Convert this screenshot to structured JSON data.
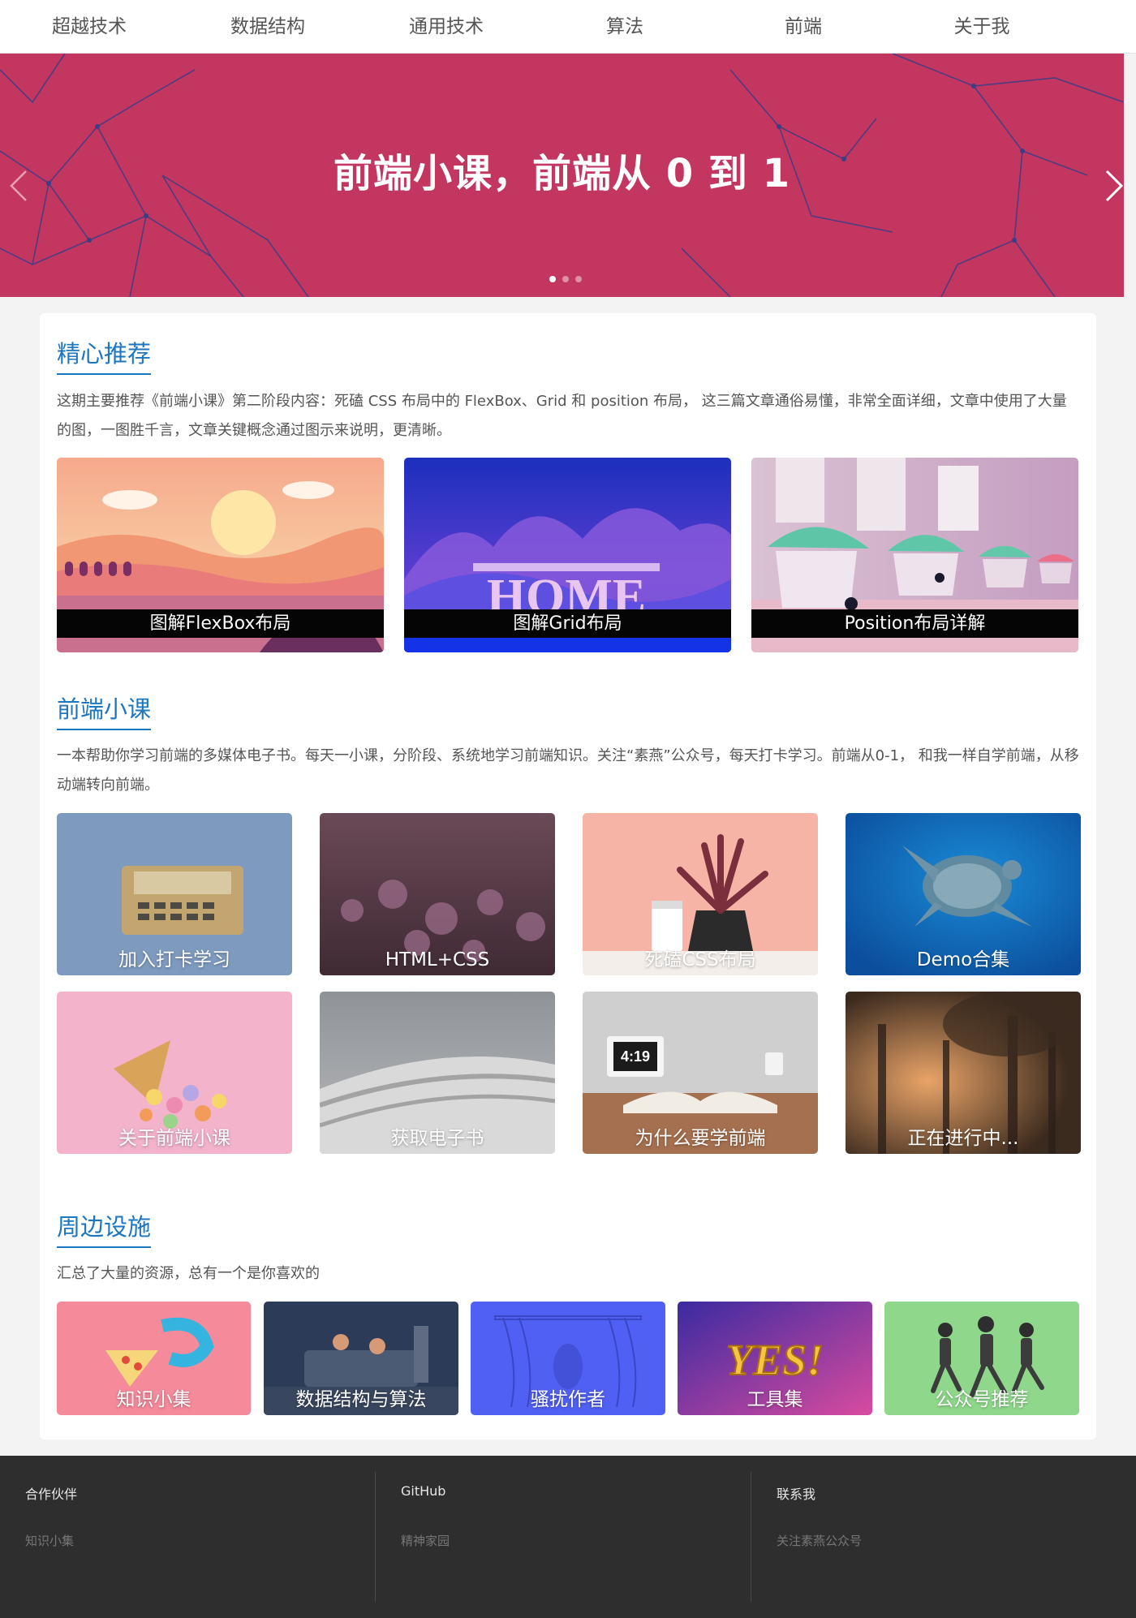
{
  "nav": {
    "items": [
      {
        "label": "超越技术"
      },
      {
        "label": "数据结构"
      },
      {
        "label": "通用技术"
      },
      {
        "label": "算法"
      },
      {
        "label": "前端"
      },
      {
        "label": "关于我"
      }
    ]
  },
  "banner": {
    "title": "前端小课，前端从 0 到 1",
    "background_color": "#c2365f",
    "slide_count": 3,
    "active_slide": 1,
    "prev_icon": "chevron-left-icon",
    "next_icon": "chevron-right-icon"
  },
  "sections": {
    "recommend": {
      "title": "精心推荐",
      "desc": "这期主要推荐《前端小课》第二阶段内容：死磕 CSS 布局中的 FlexBox、Grid 和 position 布局， 这三篇文章通俗易懂，非常全面详细，文章中使用了大量的图，一图胜千言，文章关键概念通过图示来说明，更清晰。",
      "cards": [
        {
          "label": "图解FlexBox布局"
        },
        {
          "label": "图解Grid布局"
        },
        {
          "label": "Position布局详解"
        }
      ]
    },
    "course": {
      "title": "前端小课",
      "desc": "一本帮助你学习前端的多媒体电子书。每天一小课，分阶段、系统地学习前端知识。关注“素燕”公众号，每天打卡学习。前端从0-1， 和我一样自学前端，从移动端转向前端。",
      "cards": [
        {
          "label": "加入打卡学习"
        },
        {
          "label": "HTML+CSS"
        },
        {
          "label": "死磕CSS布局"
        },
        {
          "label": "Demo合集"
        },
        {
          "label": "关于前端小课"
        },
        {
          "label": "获取电子书"
        },
        {
          "label": "为什么要学前端"
        },
        {
          "label": "正在进行中..."
        }
      ]
    },
    "facilities": {
      "title": "周边设施",
      "desc": "汇总了大量的资源，总有一个是你喜欢的",
      "cards": [
        {
          "label": "知识小集"
        },
        {
          "label": "数据结构与算法"
        },
        {
          "label": "骚扰作者"
        },
        {
          "label": "工具集"
        },
        {
          "label": "公众号推荐"
        }
      ]
    }
  },
  "footer": {
    "columns": [
      {
        "heading": "合作伙伴",
        "link": "知识小集"
      },
      {
        "heading": "GitHub",
        "link": "精神家园"
      },
      {
        "heading": "联系我",
        "link": "关注素燕公众号"
      }
    ]
  },
  "colors": {
    "accent": "#1d76c0",
    "banner": "#c2365f",
    "footer": "#2e2e2e"
  }
}
